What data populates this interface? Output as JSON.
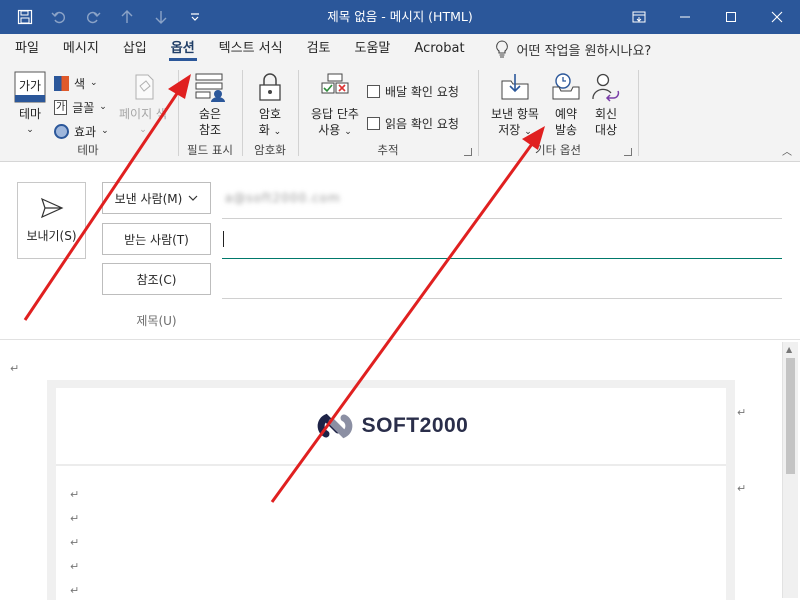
{
  "window": {
    "title": "제목 없음  -  메시지 (HTML)"
  },
  "menu": {
    "tabs": [
      "파일",
      "메시지",
      "삽입",
      "옵션",
      "텍스트 서식",
      "검토",
      "도움말",
      "Acrobat"
    ],
    "active_tab": "옵션",
    "tell_me": "어떤 작업을 원하시나요?"
  },
  "ribbon": {
    "theme_group": {
      "label": "테마",
      "theme_button": "테마",
      "color_button": "색",
      "font_button": "글꼴",
      "effect_button": "효과",
      "page_color_button": "페이지 색"
    },
    "show_fields_group": {
      "label": "필드 표시",
      "bcc_button_line1": "숨은",
      "bcc_button_line2": "참조"
    },
    "encrypt_group": {
      "label": "암호화",
      "encrypt_line1": "암호",
      "encrypt_line2": "화"
    },
    "tracking_group": {
      "label": "추적",
      "voting_line1": "응답 단추",
      "voting_line2": "사용",
      "delivery_receipt": "배달 확인 요청",
      "read_receipt": "읽음 확인 요청"
    },
    "more_options_group": {
      "label": "기타 옵션",
      "save_sent_line1": "보낸 항목",
      "save_sent_line2": "저장",
      "delay_line1": "예약",
      "delay_line2": "발송",
      "reply_line1": "회신",
      "reply_line2": "대상"
    }
  },
  "compose": {
    "send_label": "보내기(S)",
    "from_button": "보낸 사람(M)",
    "from_value": "a@soft2000.com",
    "to_button": "받는 사람(T)",
    "cc_button": "참조(C)",
    "subject_label": "제목(U)"
  },
  "body": {
    "logo_text": "SOFT2000",
    "paragraph_mark": "↵"
  },
  "colors": {
    "title_bar": "#2b579a",
    "ribbon_bg": "#f3f3f3",
    "annotation_arrow": "#e02020",
    "active_field_line": "#00796b"
  }
}
